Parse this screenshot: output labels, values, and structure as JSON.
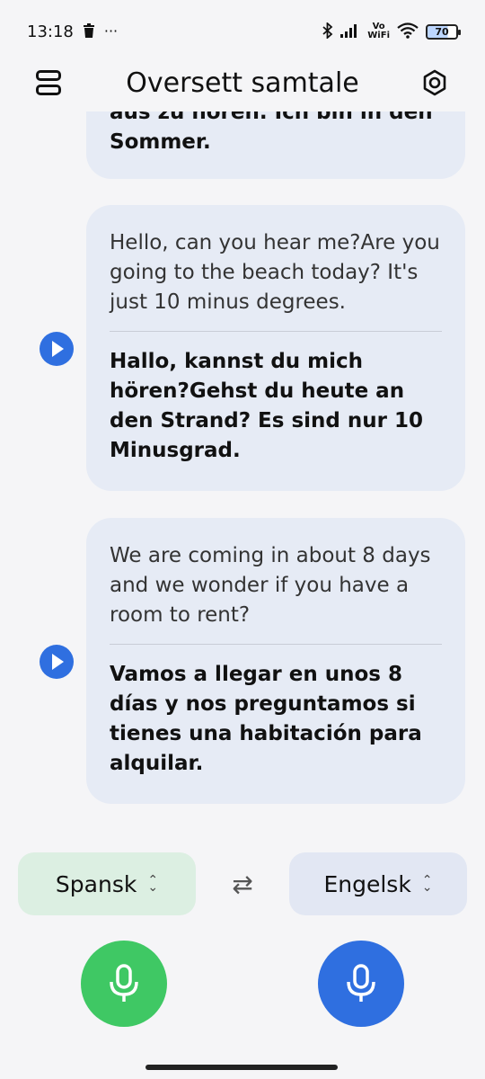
{
  "status_bar": {
    "time": "13:18",
    "left_icons": [
      "trash-icon",
      "more-dots-icon"
    ],
    "right_icons": [
      "bluetooth-icon",
      "signal-icon",
      "vowifi-icon",
      "wifi-icon",
      "battery-icon"
    ],
    "vowifi_top": "Vo",
    "vowifi_bottom": "WiFi",
    "battery": "70"
  },
  "header": {
    "title": "Oversett samtale",
    "menu_icon": "menu-icon",
    "settings_icon": "settings-icon"
  },
  "messages": [
    {
      "partial_line_1": "aus zu hören. Ich bin in den",
      "translation_tail": "Sommer."
    },
    {
      "source": "Hello, can you hear me?Are you going to the beach today? It's just 10 minus degrees.",
      "translation": "Hallo, kannst du mich hören?Gehst du heute an den Strand? Es sind nur 10 Minusgrad.",
      "play_icon": "play-icon"
    },
    {
      "source": "We are coming in about 8 days and we wonder if you have a room to rent?",
      "translation": "Vamos a llegar en unos 8 días y nos preguntamos si tienes una habitación para alquilar.",
      "play_icon": "play-icon"
    }
  ],
  "languages": {
    "source": "Spansk",
    "target": "Engelsk",
    "swap_icon": "swap-icon"
  },
  "mics": {
    "left_color": "#3fc864",
    "right_color": "#2f6fe0",
    "icon": "microphone-icon"
  },
  "colors": {
    "bubble": "#e6ebf5",
    "accent_blue": "#2f6fe0",
    "source_lang_bg": "#dcefe2",
    "target_lang_bg": "#e2e7f3"
  }
}
